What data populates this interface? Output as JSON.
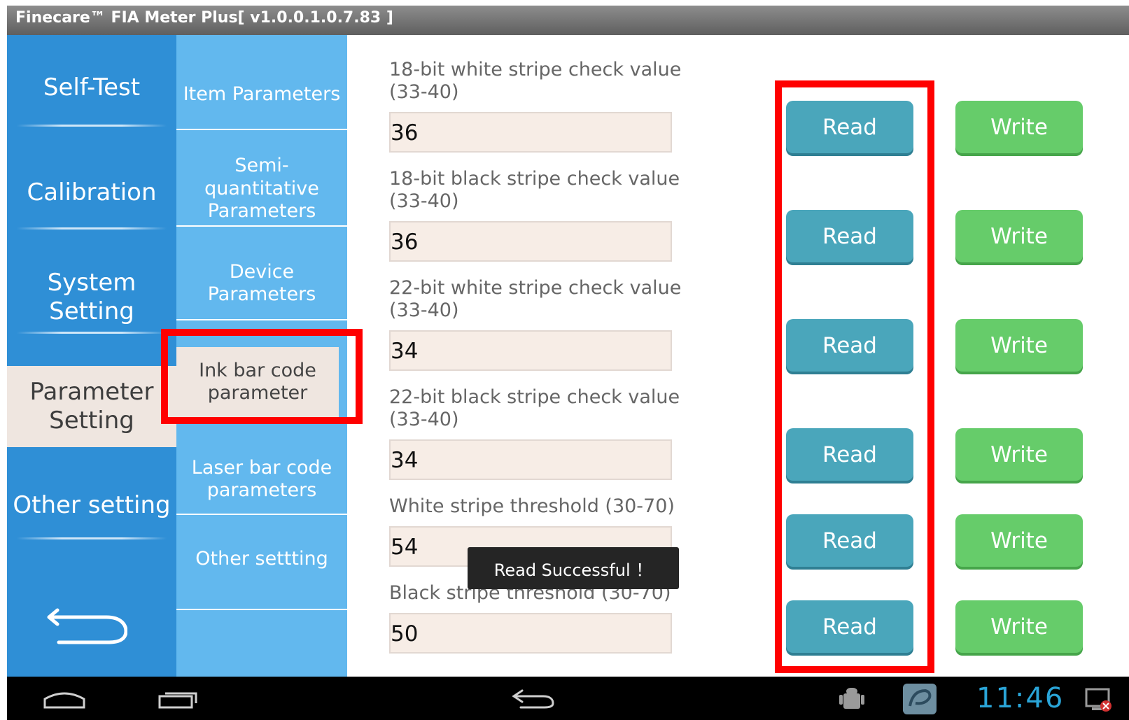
{
  "window": {
    "title": "Finecare™ FIA Meter Plus[ v1.0.0.1.0.7.83 ]"
  },
  "sidebar": {
    "items": [
      {
        "label": "Self-Test"
      },
      {
        "label": "Calibration"
      },
      {
        "label": "System Setting"
      },
      {
        "label": "Parameter Setting",
        "active": true
      },
      {
        "label": "Other setting"
      }
    ],
    "back_icon": "back-arrow-icon"
  },
  "submenu": {
    "items": [
      {
        "label": "Item Parameters"
      },
      {
        "label": "Semi-quantitative Parameters"
      },
      {
        "label": "Device Parameters"
      },
      {
        "label": "Ink bar code parameter",
        "active": true
      },
      {
        "label": "Laser bar code parameters"
      },
      {
        "label": "Other settting"
      }
    ]
  },
  "fields": [
    {
      "label": "18-bit white stripe check value (33-40)",
      "value": "36"
    },
    {
      "label": "18-bit black stripe check value (33-40)",
      "value": "36"
    },
    {
      "label": "22-bit white stripe check value (33-40)",
      "value": "34"
    },
    {
      "label": "22-bit black stripe check value (33-40)",
      "value": "34"
    },
    {
      "label": "White stripe threshold (30-70)",
      "value": "54"
    },
    {
      "label": "Black stripe threshold (30-70)",
      "value": "50"
    }
  ],
  "buttons": {
    "read_label": "Read",
    "write_label": "Write"
  },
  "toast": {
    "text": "Read Successful ！"
  },
  "statusbar": {
    "time": "11:46"
  },
  "colors": {
    "sidebar": "#2f8fd6",
    "submenu": "#62b8ee",
    "read_button": "#4aa6bb",
    "write_button": "#66cc6a",
    "highlight": "#ff0000",
    "active_item": "#efe6e0"
  }
}
